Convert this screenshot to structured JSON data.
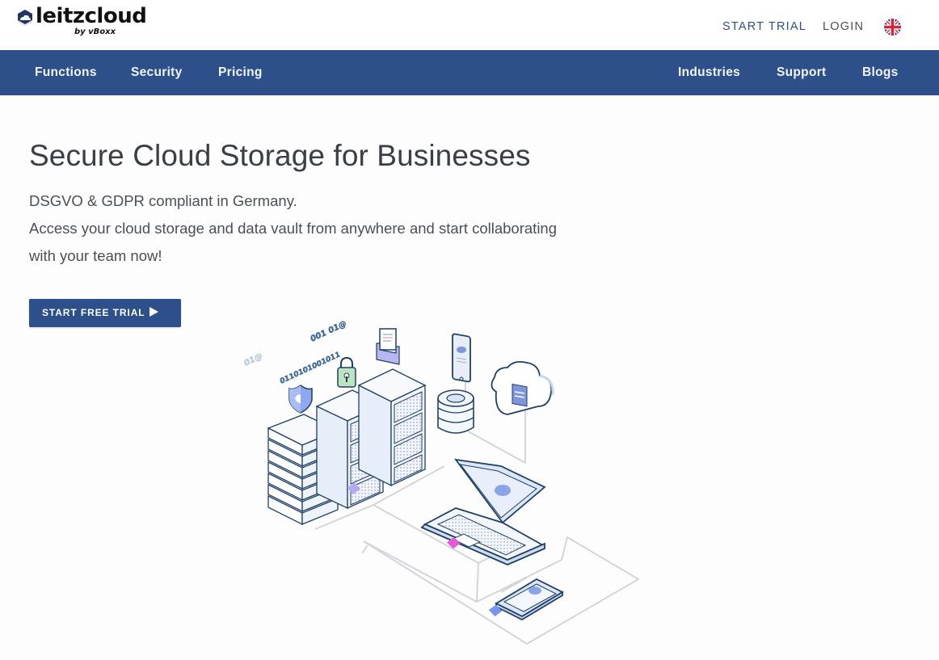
{
  "brand": {
    "name": "leitzcloud",
    "tagline": "by vBoxx"
  },
  "header": {
    "start_trial_label": "START TRIAL",
    "login_label": "LOGIN",
    "language_icon": "uk-flag-icon"
  },
  "nav": {
    "left": [
      {
        "label": "Functions"
      },
      {
        "label": "Security"
      },
      {
        "label": "Pricing"
      }
    ],
    "right": [
      {
        "label": "Industries"
      },
      {
        "label": "Support"
      },
      {
        "label": "Blogs"
      }
    ]
  },
  "hero": {
    "title": "Secure Cloud Storage for Businesses",
    "lines": [
      "DSGVO & GDPR compliant in Germany.",
      "Access your cloud storage and data vault from anywhere and start collaborating",
      "with your team now!"
    ],
    "cta_label": "START FREE TRIAL",
    "cta_icon": "play-arrow-icon"
  },
  "illustration": {
    "binary_texts": [
      "01@",
      "001 01@",
      "0110101001011"
    ],
    "icons": [
      "shield-icon",
      "padlock-icon",
      "document-tray-icon",
      "smartphone-icon",
      "database-icon",
      "cloud-save-icon",
      "server-rack-icon",
      "laptop-icon",
      "tablet-icon"
    ]
  },
  "colors": {
    "brand_blue": "#2d4f8a",
    "text_dark": "#3a3f47",
    "line_dark": "#1f3f66",
    "accent_lavender": "#b3a9f5",
    "accent_pink": "#e55bd7",
    "accent_blue": "#7b93f0",
    "accent_green": "#bde4bf"
  }
}
